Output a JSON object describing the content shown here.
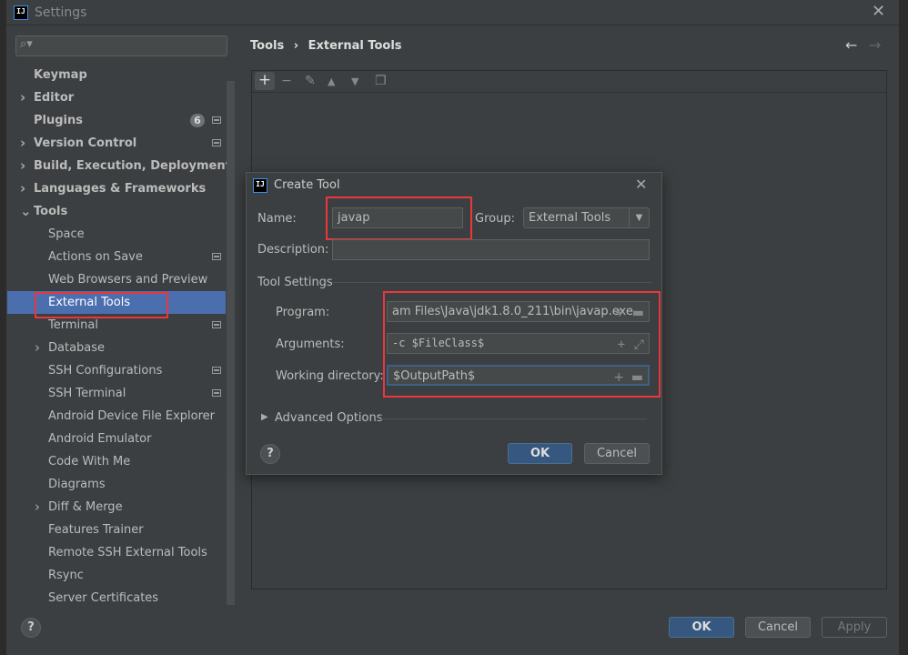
{
  "window": {
    "title": "Settings",
    "logo": "IJ"
  },
  "search": {
    "placeholder": ""
  },
  "sidebar": {
    "items": [
      {
        "label": "Keymap",
        "bold": true
      },
      {
        "label": "Editor",
        "bold": true,
        "expandable": true
      },
      {
        "label": "Plugins",
        "bold": true,
        "badge": "6"
      },
      {
        "label": "Version Control",
        "bold": true,
        "expandable": true
      },
      {
        "label": "Build, Execution, Deployment",
        "bold": true,
        "expandable": true
      },
      {
        "label": "Languages & Frameworks",
        "bold": true,
        "expandable": true
      },
      {
        "label": "Tools",
        "bold": true,
        "expanded": true
      },
      {
        "label": "Space"
      },
      {
        "label": "Actions on Save"
      },
      {
        "label": "Web Browsers and Preview"
      },
      {
        "label": "External Tools",
        "selected": true
      },
      {
        "label": "Terminal"
      },
      {
        "label": "Database",
        "expandable": true
      },
      {
        "label": "SSH Configurations"
      },
      {
        "label": "SSH Terminal"
      },
      {
        "label": "Android Device File Explorer"
      },
      {
        "label": "Android Emulator"
      },
      {
        "label": "Code With Me"
      },
      {
        "label": "Diagrams"
      },
      {
        "label": "Diff & Merge",
        "expandable": true
      },
      {
        "label": "Features Trainer"
      },
      {
        "label": "Remote SSH External Tools"
      },
      {
        "label": "Rsync"
      },
      {
        "label": "Server Certificates"
      }
    ]
  },
  "breadcrumb": {
    "parent": "Tools",
    "separator": "›",
    "current": "External Tools"
  },
  "dialog": {
    "title": "Create Tool",
    "logo": "IJ",
    "name_label": "Name:",
    "name_value": "javap",
    "group_label": "Group:",
    "group_value": "External Tools",
    "description_label": "Description:",
    "description_value": "",
    "section": "Tool Settings",
    "program_label": "Program:",
    "program_value": "am Files\\Java\\jdk1.8.0_211\\bin\\javap.exe",
    "arguments_label": "Arguments:",
    "arguments_value": "-c $FileClass$",
    "workdir_label": "Working directory:",
    "workdir_value": "$OutputPath$",
    "advanced": "Advanced Options",
    "ok": "OK",
    "cancel": "Cancel",
    "help": "?"
  },
  "footer": {
    "ok": "OK",
    "cancel": "Cancel",
    "apply": "Apply",
    "help": "?"
  },
  "colors": {
    "selection": "#4b6eaf",
    "highlight": "#e8383d",
    "ok_button": "#365880"
  }
}
